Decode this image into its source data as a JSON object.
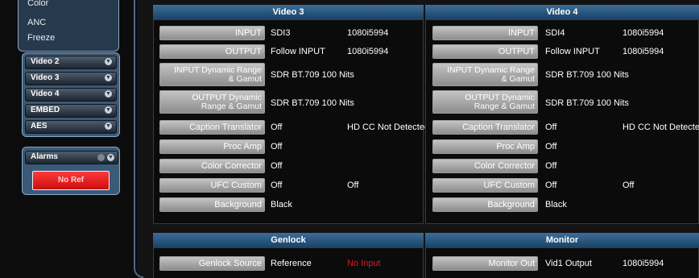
{
  "sidebar": {
    "sub_items": [
      "Color",
      "ANC",
      "Freeze"
    ],
    "nav_items": [
      {
        "label": "Video 2"
      },
      {
        "label": "Video 3"
      },
      {
        "label": "Video 4"
      },
      {
        "label": "EMBED"
      },
      {
        "label": "AES"
      }
    ],
    "alarms": {
      "label": "Alarms",
      "alarm_button": "No Ref"
    }
  },
  "video3": {
    "title": "Video 3",
    "rows": [
      {
        "button": "INPUT",
        "values": [
          "SDI3",
          "1080i5994"
        ]
      },
      {
        "button": "OUTPUT",
        "values": [
          "Follow INPUT",
          "1080i5994"
        ]
      },
      {
        "button_line1": "INPUT Dynamic Range",
        "button_line2": "& Gamut",
        "values": [
          "SDR BT.709 100 Nits"
        ]
      },
      {
        "button_line1": "OUTPUT Dynamic",
        "button_line2": "Range & Gamut",
        "values": [
          "SDR BT.709 100 Nits"
        ]
      },
      {
        "button": "Caption Translator",
        "values": [
          "Off",
          "HD CC Not Detected"
        ]
      },
      {
        "button": "Proc Amp",
        "values": [
          "Off"
        ]
      },
      {
        "button": "Color Corrector",
        "values": [
          "Off"
        ]
      },
      {
        "button": "UFC Custom",
        "values": [
          "Off",
          "Off"
        ]
      },
      {
        "button": "Background",
        "values": [
          "Black"
        ]
      }
    ]
  },
  "video4": {
    "title": "Video 4",
    "rows": [
      {
        "button": "INPUT",
        "values": [
          "SDI4",
          "1080i5994"
        ]
      },
      {
        "button": "OUTPUT",
        "values": [
          "Follow INPUT",
          "1080i5994"
        ]
      },
      {
        "button_line1": "INPUT Dynamic Range",
        "button_line2": "& Gamut",
        "values": [
          "SDR BT.709 100 Nits"
        ]
      },
      {
        "button_line1": "OUTPUT Dynamic",
        "button_line2": "Range & Gamut",
        "values": [
          "SDR BT.709 100 Nits"
        ]
      },
      {
        "button": "Caption Translator",
        "values": [
          "Off",
          "HD CC Not Detecte"
        ]
      },
      {
        "button": "Proc Amp",
        "values": [
          "Off"
        ]
      },
      {
        "button": "Color Corrector",
        "values": [
          "Off"
        ]
      },
      {
        "button": "UFC Custom",
        "values": [
          "Off",
          "Off"
        ]
      },
      {
        "button": "Background",
        "values": [
          "Black"
        ]
      }
    ]
  },
  "genlock": {
    "title": "Genlock",
    "button": "Genlock Source",
    "values": [
      "Reference",
      "No Input"
    ]
  },
  "monitor": {
    "title": "Monitor",
    "button": "Monitor Out",
    "values": [
      "Vid1 Output",
      "1080i5994"
    ]
  },
  "colors": {
    "title_bar": "#2c5a82",
    "alarm_red": "#e01a1a",
    "sidebar_blue": "#3a5a78"
  }
}
